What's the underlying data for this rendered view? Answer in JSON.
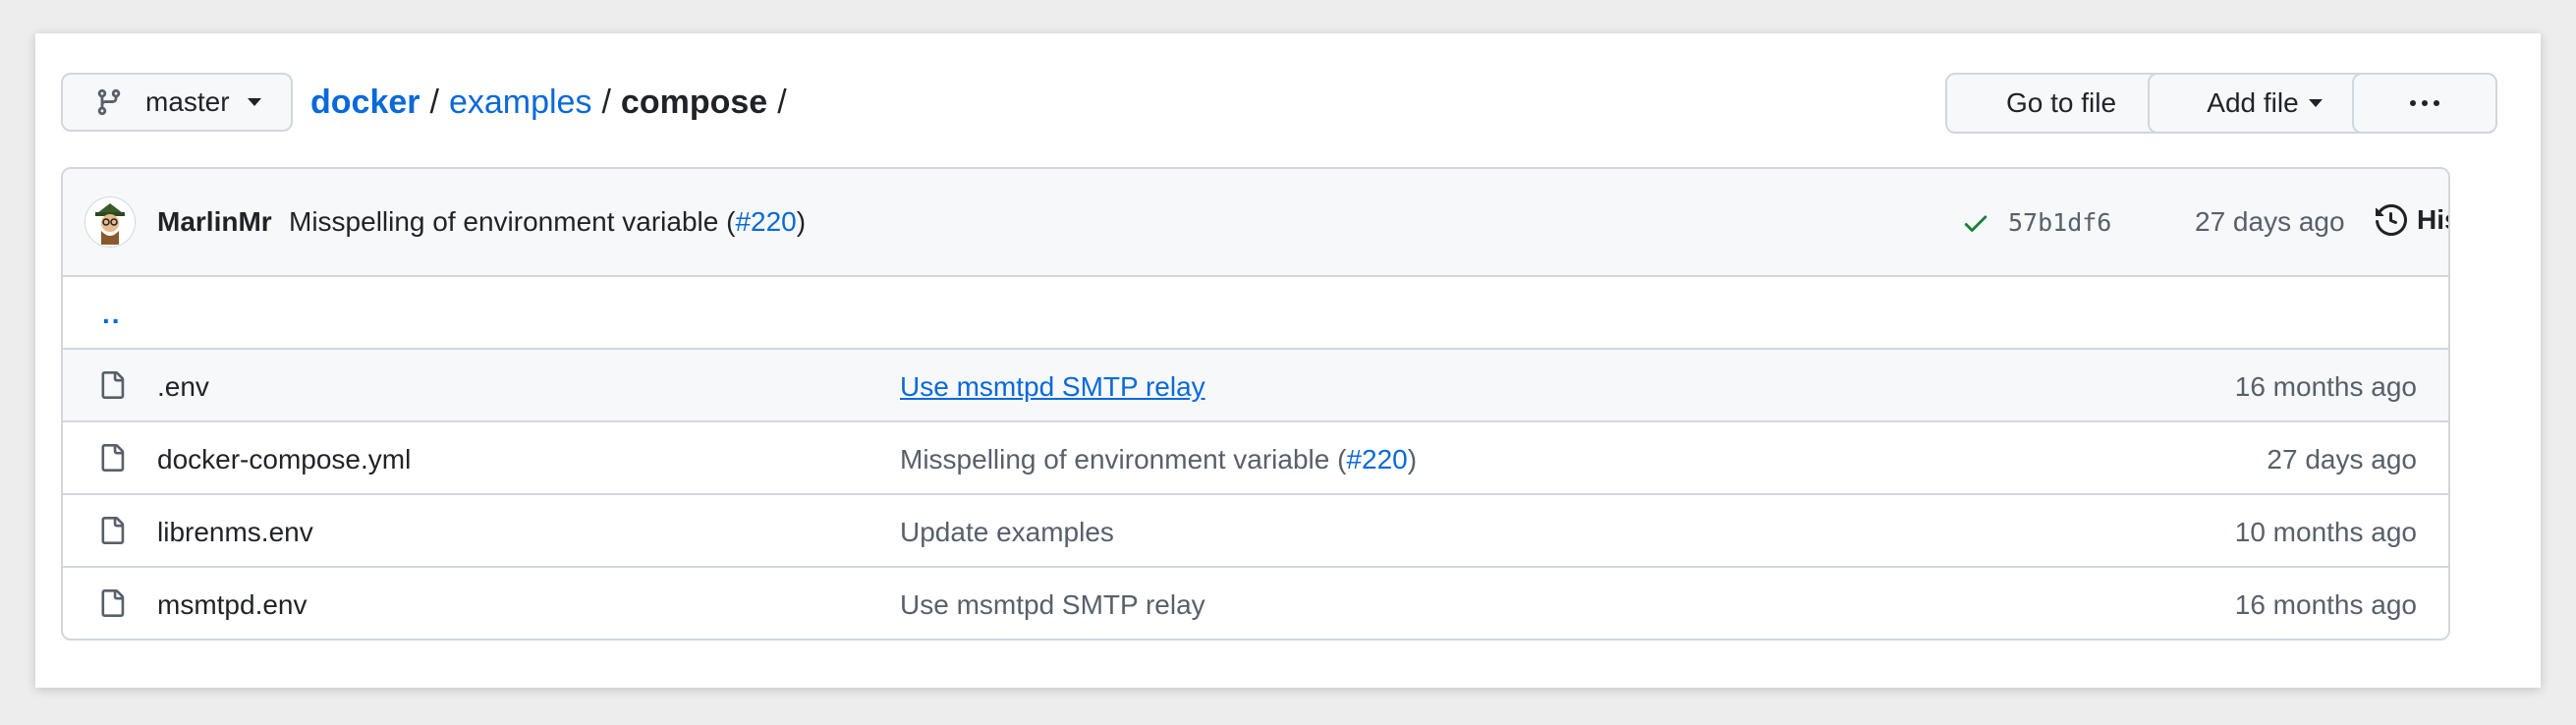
{
  "branch": {
    "name": "master"
  },
  "breadcrumb": {
    "repo": "docker",
    "dir": "examples",
    "current": "compose",
    "separator": "/"
  },
  "toolbar": {
    "go_to_file": "Go to file",
    "add_file": "Add file"
  },
  "commit": {
    "author": "MarlinMr",
    "message": "Misspelling of environment variable (",
    "pr": "#220",
    "message_end": ")",
    "sha": "57b1df6",
    "ago": "27 days ago",
    "history_label": "History"
  },
  "parent_link": "..",
  "files": [
    {
      "name": ".env",
      "message": "Use msmtpd SMTP relay",
      "ago": "16 months ago"
    },
    {
      "name": "docker-compose.yml",
      "message": "Misspelling of environment variable (",
      "pr": "#220",
      "message_end": ")",
      "ago": "27 days ago"
    },
    {
      "name": "librenms.env",
      "message": "Update examples",
      "ago": "10 months ago"
    },
    {
      "name": "msmtpd.env",
      "message": "Use msmtpd SMTP relay",
      "ago": "16 months ago"
    }
  ],
  "colors": {
    "link": "#0969da",
    "success": "#1a7f37",
    "border": "#d0d7de",
    "muted": "#57606a"
  }
}
